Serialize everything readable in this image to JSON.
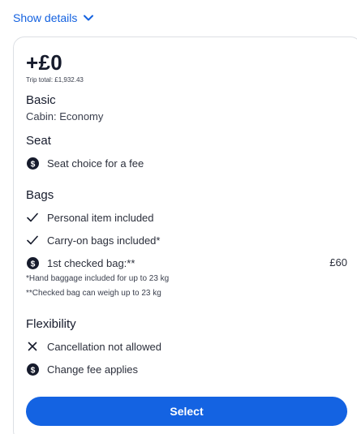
{
  "show_details": {
    "label": "Show details",
    "icon": "chevron-down-icon"
  },
  "fare": {
    "price": "+£0",
    "trip_total": "Trip total: £1,932.43",
    "name": "Basic",
    "cabin": "Cabin: Economy"
  },
  "seat": {
    "title": "Seat",
    "items": [
      {
        "icon": "dollar-circle-icon",
        "text": "Seat choice for a fee"
      }
    ]
  },
  "bags": {
    "title": "Bags",
    "items": [
      {
        "icon": "check-icon",
        "text": "Personal item included"
      },
      {
        "icon": "check-icon",
        "text": "Carry-on bags included*"
      },
      {
        "icon": "dollar-circle-icon",
        "text": "1st checked bag:**",
        "price": "£60"
      }
    ],
    "notes": [
      "*Hand baggage included for up to 23 kg",
      "**Checked bag can weigh up to 23 kg"
    ]
  },
  "flexibility": {
    "title": "Flexibility",
    "items": [
      {
        "icon": "x-icon",
        "text": "Cancellation not allowed"
      },
      {
        "icon": "dollar-circle-icon",
        "text": "Change fee applies"
      }
    ]
  },
  "select_button": {
    "label": "Select"
  },
  "colors": {
    "link": "#1462e0",
    "button": "#1463e2",
    "text": "#161b2c",
    "border": "#dcdfe4"
  }
}
